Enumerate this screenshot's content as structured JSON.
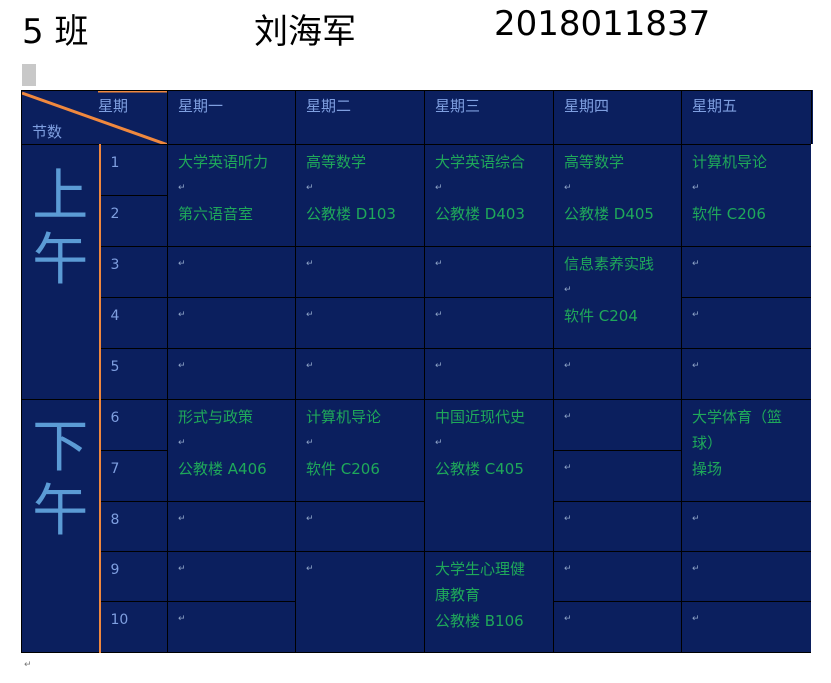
{
  "header": {
    "class_label": "5 班",
    "student_name": "刘海军",
    "student_id": "2018011837"
  },
  "marks": {
    "para": "↵"
  },
  "table": {
    "corner_top": "星期",
    "corner_bottom": "节数",
    "days": [
      "星期一",
      "星期二",
      "星期三",
      "星期四",
      "星期五"
    ],
    "morning": "上午",
    "afternoon": "下午",
    "periods": [
      "1",
      "2",
      "3",
      "4",
      "5",
      "6",
      "7",
      "8",
      "9",
      "10"
    ],
    "courses": {
      "mon_am": [
        "大学英语听力",
        "",
        "第六语音室"
      ],
      "tue_am": [
        "高等数学",
        "",
        "公教楼 D103"
      ],
      "wed_am": [
        "大学英语综合",
        "",
        "公教楼 D403"
      ],
      "thu_am": [
        "高等数学",
        "",
        "公教楼 D405"
      ],
      "fri_am": [
        "计算机导论",
        "",
        "软件 C206"
      ],
      "thu_34": [
        "信息素养实践",
        "",
        "软件 C204"
      ],
      "mon_pm": [
        "形式与政策",
        "",
        "公教楼 A406"
      ],
      "tue_pm": [
        "计算机导论",
        "",
        "软件 C206"
      ],
      "wed_pm": [
        "中国近现代史",
        "",
        "公教楼 C405"
      ],
      "fri_pm": [
        "大学体育（篮",
        "球）",
        "操场"
      ],
      "wed_910": [
        "大学生心理健",
        "康教育",
        "公教楼 B106"
      ]
    }
  },
  "colors": {
    "table_bg": "#0b1f5e",
    "course_text": "#1fa85a",
    "head_text": "#7f9fe0",
    "half_text": "#5b9bd5",
    "accent_line": "#f0883e"
  }
}
